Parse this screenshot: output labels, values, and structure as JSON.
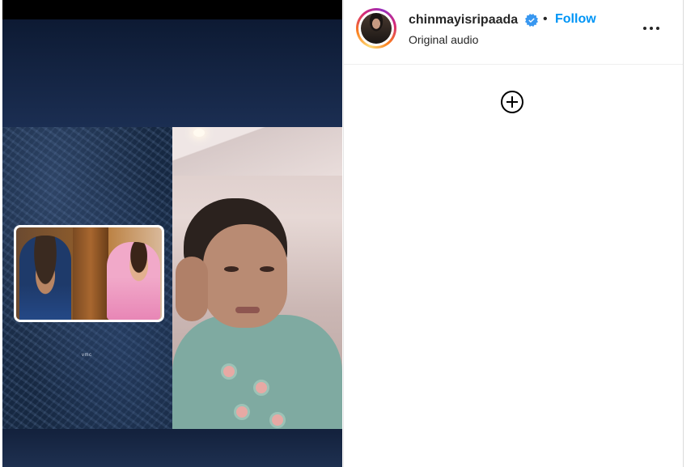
{
  "post": {
    "username": "chinmayisripaada",
    "follow_label": "Follow",
    "separator": "•",
    "audio": "Original audio",
    "verified": true
  },
  "media": {
    "watermark": "vmc"
  },
  "icons": {
    "verified": "verified-badge-icon",
    "more": "more-options-icon",
    "add": "add-circle-icon"
  },
  "colors": {
    "follow": "#0095f6",
    "verified": "#3897f0",
    "text": "#262626"
  }
}
